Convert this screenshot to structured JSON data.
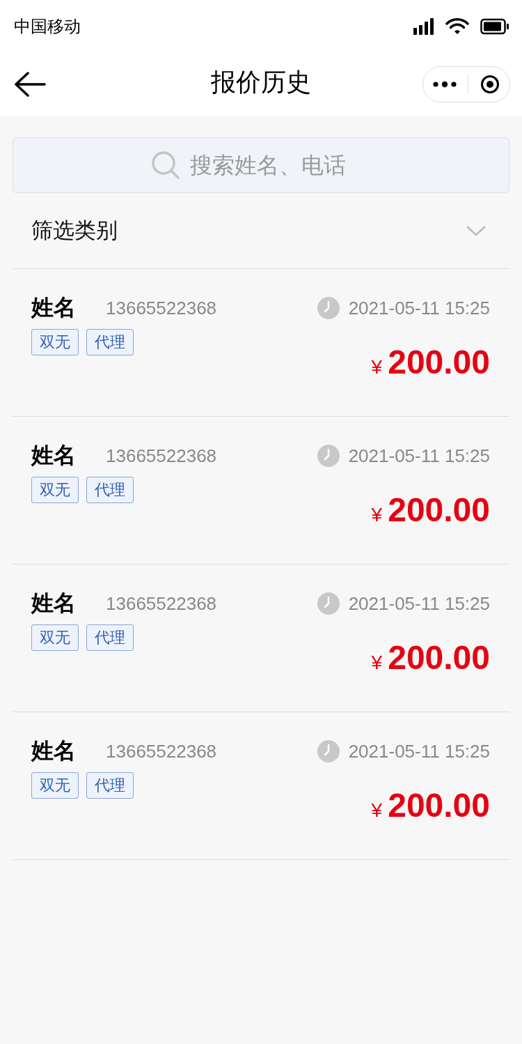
{
  "status_bar": {
    "carrier": "中国移动"
  },
  "nav": {
    "title": "报价历史"
  },
  "search": {
    "placeholder": "搜索姓名、电话"
  },
  "filter": {
    "label": "筛选类别"
  },
  "records": [
    {
      "name": "姓名",
      "phone": "13665522368",
      "time": "2021-05-11 15:25",
      "tags": [
        "双无",
        "代理"
      ],
      "currency": "¥",
      "amount": "200.00"
    },
    {
      "name": "姓名",
      "phone": "13665522368",
      "time": "2021-05-11 15:25",
      "tags": [
        "双无",
        "代理"
      ],
      "currency": "¥",
      "amount": "200.00"
    },
    {
      "name": "姓名",
      "phone": "13665522368",
      "time": "2021-05-11 15:25",
      "tags": [
        "双无",
        "代理"
      ],
      "currency": "¥",
      "amount": "200.00"
    },
    {
      "name": "姓名",
      "phone": "13665522368",
      "time": "2021-05-11 15:25",
      "tags": [
        "双无",
        "代理"
      ],
      "currency": "¥",
      "amount": "200.00"
    }
  ]
}
